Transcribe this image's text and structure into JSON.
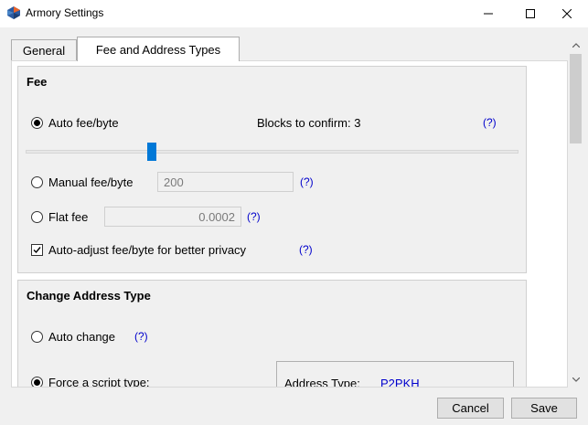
{
  "window": {
    "title": "Armory Settings"
  },
  "tabs": [
    {
      "label": "General",
      "active": false
    },
    {
      "label": "Fee and Address Types",
      "active": true
    }
  ],
  "fee": {
    "title": "Fee",
    "auto": {
      "label": "Auto fee/byte",
      "selected": true
    },
    "blocks_label": "Blocks to confirm: 3",
    "help": "(?)",
    "slider_level": 0.25,
    "manual": {
      "label": "Manual fee/byte",
      "value": "200",
      "selected": false
    },
    "flat": {
      "label": "Flat fee",
      "value": "0.0002",
      "selected": false
    },
    "privacy": {
      "label": "Auto-adjust fee/byte for better privacy",
      "checked": true
    }
  },
  "address": {
    "title": "Change Address Type",
    "auto_change": {
      "label": "Auto change",
      "selected": false
    },
    "force": {
      "label": "Force a script type:",
      "selected": true
    },
    "type_label": "Address Type:",
    "type_value": "P2PKH"
  },
  "buttons": {
    "cancel": "Cancel",
    "save": "Save"
  },
  "colors": {
    "accent": "#0078d7",
    "help_link": "#0000cc",
    "address_value": "#0000cc"
  }
}
